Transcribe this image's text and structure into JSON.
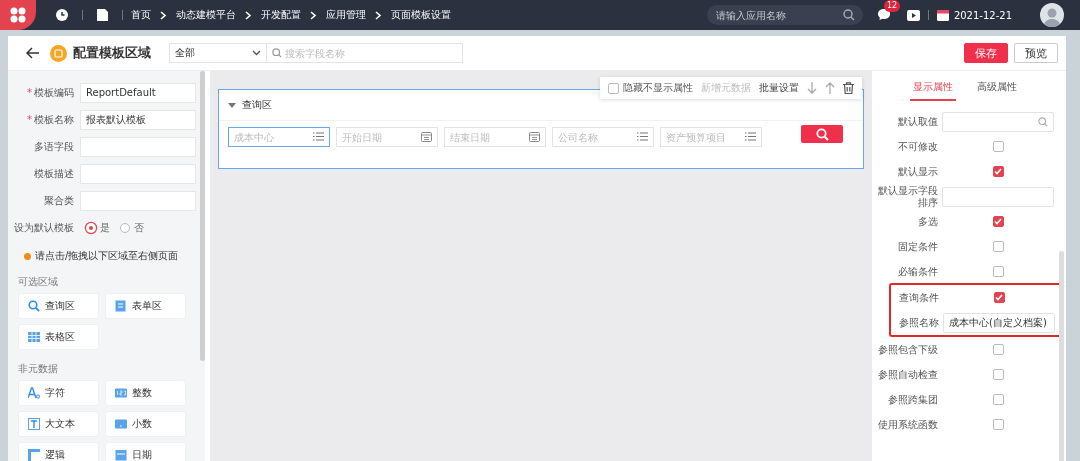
{
  "topbar": {
    "breadcrumbs": [
      "首页",
      "动态建模平台",
      "开发配置",
      "应用管理",
      "页面模板设置"
    ],
    "search_placeholder": "请输入应用名称",
    "notification_count": "12",
    "date": "2021-12-21"
  },
  "header": {
    "title": "配置模板区域",
    "filter": "全部",
    "search_placeholder": "搜索字段名称",
    "buttons": [
      {
        "label": "保存",
        "kind": "primary"
      },
      {
        "label": "预览",
        "kind": "default"
      }
    ]
  },
  "left": {
    "fields": [
      {
        "label": "模板编码",
        "required_mark": "*",
        "value": "ReportDefault"
      },
      {
        "label": "模板名称",
        "required_mark": "*",
        "value": "报表默认模板"
      },
      {
        "label": "多语字段"
      },
      {
        "label": "模板描述"
      },
      {
        "label": "聚合类"
      }
    ],
    "default_template": {
      "label": "设为默认模板",
      "options": [
        {
          "label": "是",
          "selected": true
        },
        {
          "label": "否",
          "selected": false
        }
      ]
    },
    "hint": "请点击/拖拽以下区域至右侧页面",
    "sections": [
      {
        "title": "可选区域",
        "items": [
          {
            "label": "查询区",
            "kind": "search"
          },
          {
            "label": "表单区",
            "kind": "form"
          },
          {
            "label": "表格区",
            "kind": "table"
          }
        ]
      },
      {
        "title": "非元数据",
        "items": [
          {
            "label": "字符",
            "kind": "char"
          },
          {
            "label": "整数",
            "kind": "integer"
          },
          {
            "label": "大文本",
            "kind": "text"
          },
          {
            "label": "小数",
            "kind": "decimal"
          },
          {
            "label": "逻辑",
            "kind": "logic"
          },
          {
            "label": "日期",
            "kind": "date"
          }
        ]
      }
    ]
  },
  "canvas": {
    "toolbar": {
      "hide_checkbox": {
        "label": "隐藏不显示属性",
        "checked": false
      },
      "actions": [
        {
          "label": "新增元数据",
          "disabled": true
        },
        {
          "label": "批量设置",
          "disabled": false
        }
      ]
    },
    "query_area": {
      "title": "查询区",
      "fields": [
        {
          "placeholder": "成本中心",
          "kind": "list",
          "selected": true
        },
        {
          "placeholder": "开始日期",
          "kind": "date",
          "selected": false
        },
        {
          "placeholder": "结束日期",
          "kind": "date",
          "selected": false
        },
        {
          "placeholder": "公司名称",
          "kind": "list",
          "selected": false
        },
        {
          "placeholder": "资产预算项目",
          "kind": "list",
          "selected": false
        }
      ]
    }
  },
  "right": {
    "tabs": [
      {
        "label": "显示属性",
        "selected": true
      },
      {
        "label": "高级属性",
        "selected": false
      }
    ],
    "groups": [
      {
        "highlighted": false,
        "rows": [
          {
            "label": "默认取值",
            "kind": "search"
          },
          {
            "label": "不可修改",
            "kind": "checkbox",
            "checked": false
          },
          {
            "label": "默认显示",
            "kind": "checkbox",
            "checked": true
          },
          {
            "label": "默认显示字段排序",
            "kind": "text"
          },
          {
            "label": "多选",
            "kind": "checkbox",
            "checked": true
          },
          {
            "label": "固定条件",
            "kind": "checkbox",
            "checked": false
          },
          {
            "label": "必输条件",
            "kind": "checkbox",
            "checked": false
          }
        ]
      },
      {
        "highlighted": true,
        "rows": [
          {
            "label": "查询条件",
            "kind": "checkbox",
            "checked": true
          },
          {
            "label": "参照名称",
            "kind": "text",
            "value": "成本中心(自定义档案)"
          }
        ]
      },
      {
        "highlighted": false,
        "rows": [
          {
            "label": "参照包含下级",
            "kind": "checkbox",
            "checked": false
          },
          {
            "label": "参照自动检查",
            "kind": "checkbox",
            "checked": false
          },
          {
            "label": "参照跨集团",
            "kind": "checkbox",
            "checked": false
          },
          {
            "label": "使用系统函数",
            "kind": "checkbox",
            "checked": false
          }
        ]
      }
    ]
  }
}
